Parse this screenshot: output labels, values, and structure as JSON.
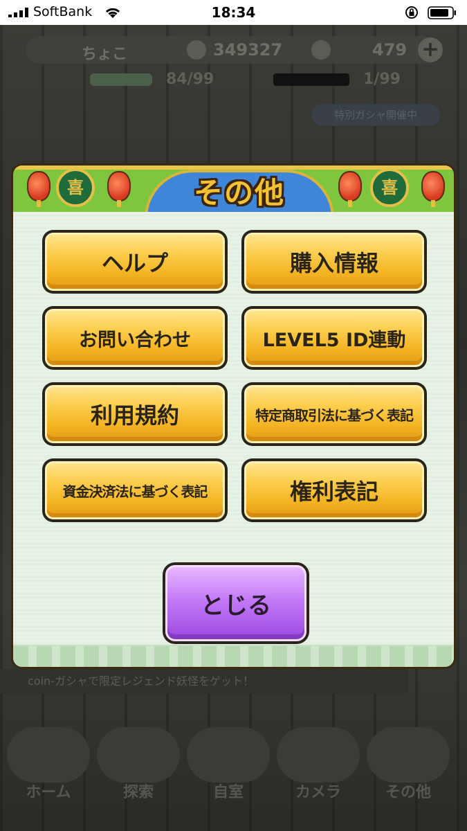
{
  "status_bar": {
    "carrier": "SoftBank",
    "time": "18:34"
  },
  "background": {
    "player_name": "ちょこ",
    "coins": "349327",
    "gems": "479",
    "plus": "+",
    "stamina": "84/99",
    "tickets": "1/99",
    "pill_text": "特別ガシャ開催中",
    "ticker": "coin-ガシャで限定レジェンド妖怪をゲット！",
    "nav": [
      "ホーム",
      "探索",
      "自室",
      "カメラ",
      "その他"
    ]
  },
  "modal": {
    "title": "その他",
    "medallion_glyph": "喜",
    "buttons": [
      {
        "label": "ヘルプ"
      },
      {
        "label": "購入情報"
      },
      {
        "label": "お問い合わせ"
      },
      {
        "label": "LEVEL5 ID連動"
      },
      {
        "label": "利用規約"
      },
      {
        "label": "特定商取引法に基づく表記"
      },
      {
        "label": "資金決済法に基づく表記"
      },
      {
        "label": "権利表記"
      }
    ],
    "close_label": "とじる"
  },
  "colors": {
    "header_green": "#7fc63e",
    "title_blue": "#3f86d8",
    "button_gold": "#f4b524",
    "close_purple": "#c47af7",
    "body_mint": "#e2efe1"
  }
}
